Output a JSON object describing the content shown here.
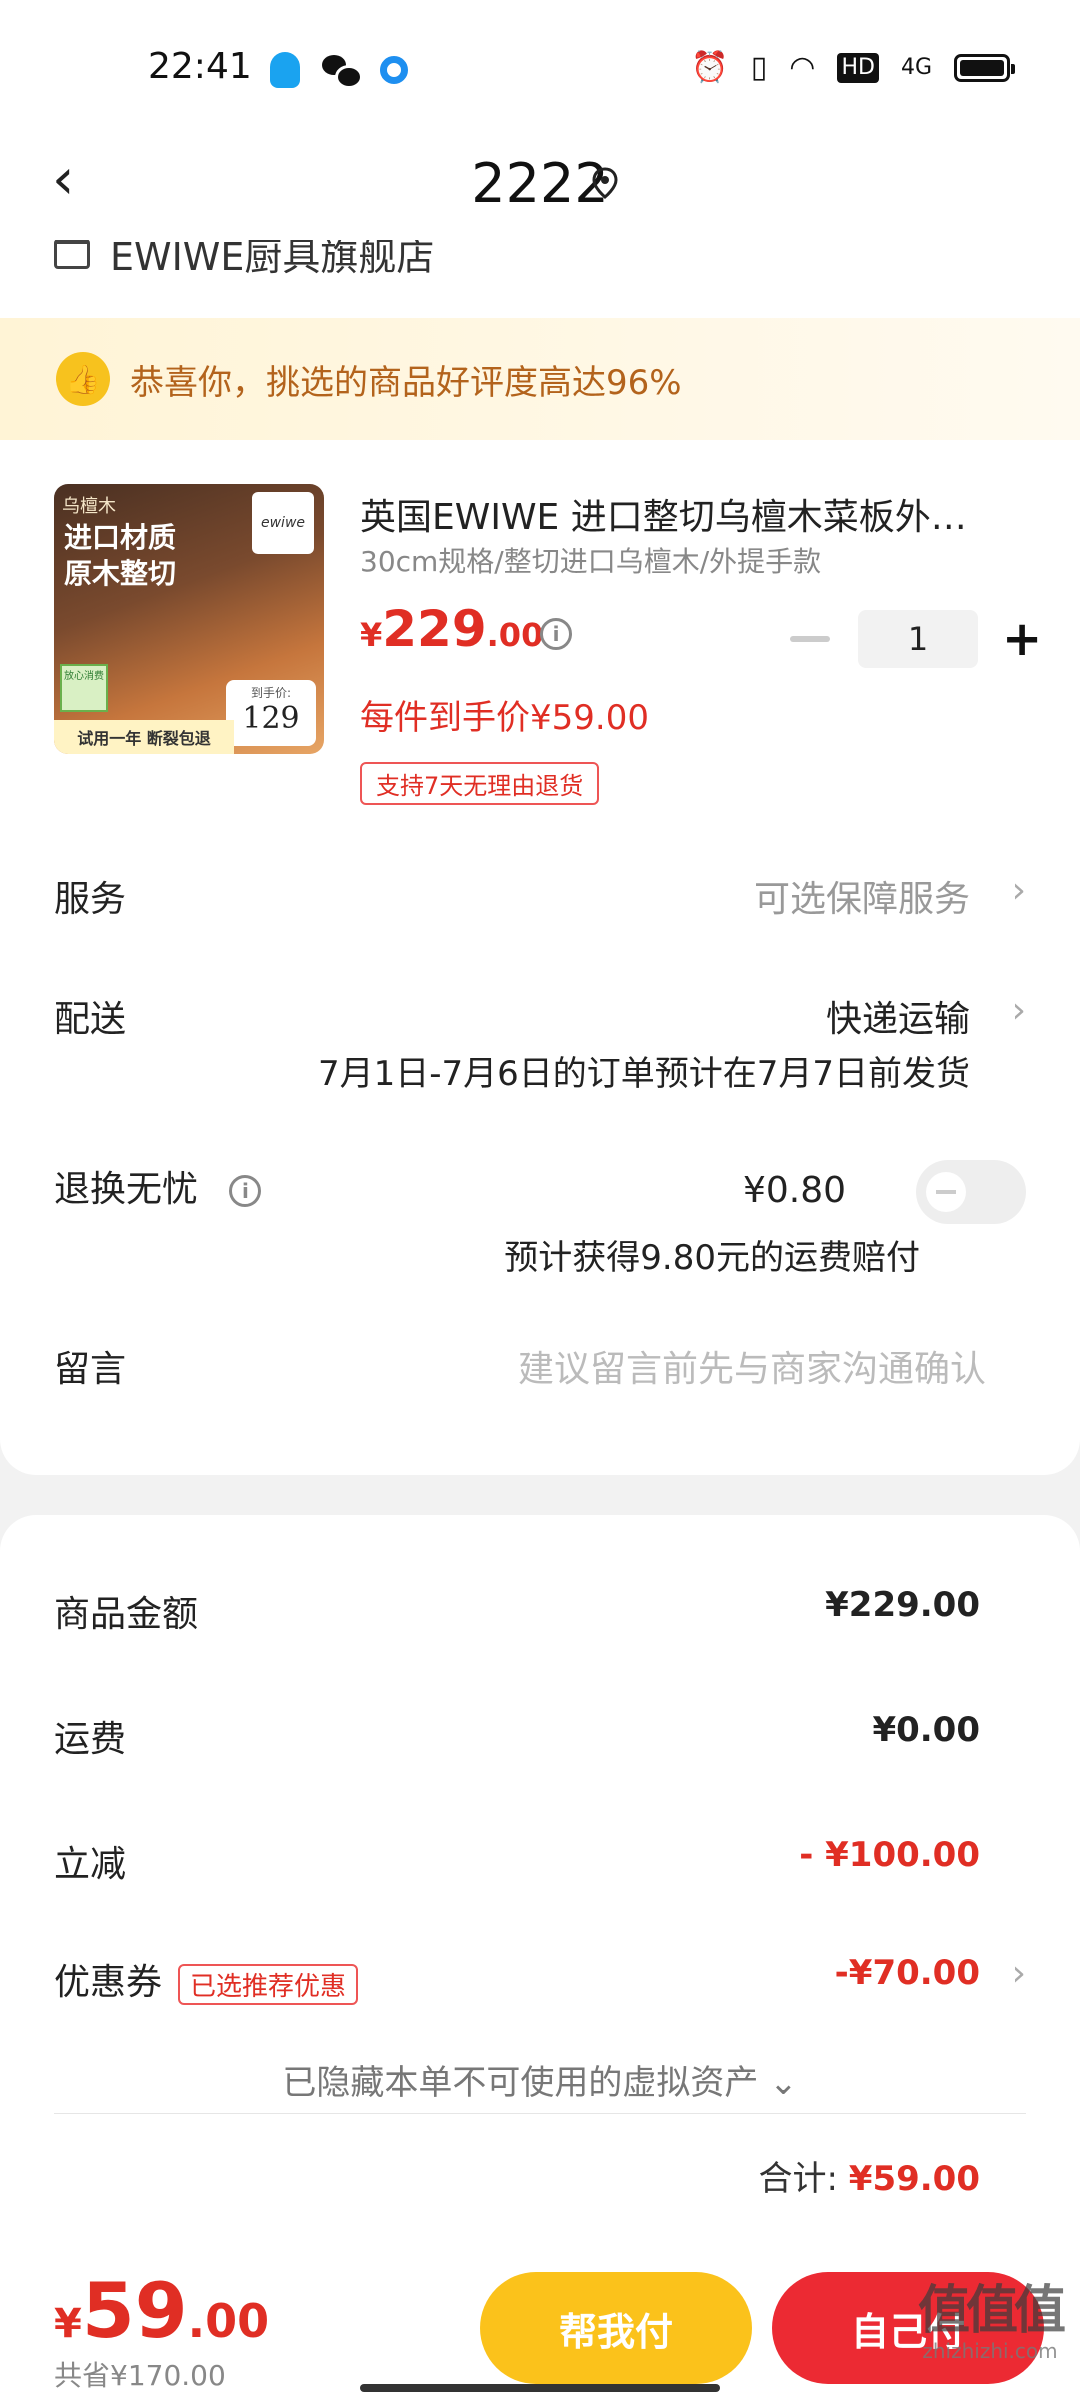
{
  "status_bar": {
    "time": "22:41",
    "network": "4G",
    "hd_label": "HD"
  },
  "header": {
    "title": "2222",
    "back_glyph": "‹"
  },
  "store": {
    "name": "EWIWE厨具旗舰店"
  },
  "congrats": {
    "text": "恭喜你，挑选的商品好评度高达96%",
    "icon": "thumbs-up-icon"
  },
  "product": {
    "image_texts": {
      "top_left": "乌檀木",
      "logo": "ewiwe",
      "headline_1": "进口材质",
      "headline_2": "原木整切",
      "badge": "放心消费",
      "price_label": "到手价:",
      "price": "129",
      "bottom": "试用一年 断裂包退"
    },
    "title": "英国EWIWE 进口整切乌檀木菜板外提手款",
    "spec": "30cm规格/整切进口乌檀木/外提手款",
    "price_symbol": "¥",
    "price_int": "229",
    "price_dec": ".00",
    "quantity": "1",
    "unit_price_text": "每件到手价¥59.00",
    "return_policy": "支持7天无理由退货"
  },
  "rows": {
    "service": {
      "label": "服务",
      "value": "可选保障服务"
    },
    "delivery": {
      "label": "配送",
      "value": "快递运输",
      "note": "7月1日-7月6日的订单预计在7月7日前发货"
    },
    "worry_free": {
      "label": "退换无忧",
      "price": "¥0.80",
      "note": "预计获得9.80元的运费赔付",
      "enabled": false
    },
    "message": {
      "label": "留言",
      "placeholder": "建议留言前先与商家沟通确认"
    }
  },
  "summary": {
    "goods_label": "商品金额",
    "goods_value": "¥229.00",
    "shipping_label": "运费",
    "shipping_value": "¥0.00",
    "discount_label": "立减",
    "discount_value": "- ¥100.00",
    "coupon_label": "优惠券",
    "coupon_tag": "已选推荐优惠",
    "coupon_value": "-¥70.00",
    "hidden_assets": "已隐藏本单不可使用的虚拟资产 ⌄",
    "total_label": "合计:",
    "total_value": "¥59.00"
  },
  "bottom_bar": {
    "price_symbol": "¥",
    "price_int": "59",
    "price_dec": ".00",
    "saved": "共省¥170.00",
    "friend_pay": "帮我付",
    "self_pay": "自己付"
  },
  "watermark": {
    "logo": "值值值",
    "url": "zhizhizhi.com"
  },
  "colors": {
    "accent_red": "#e02e24",
    "button_yellow": "#fbc21b",
    "button_red": "#ec2a33",
    "congrats_text": "#b3631c"
  }
}
